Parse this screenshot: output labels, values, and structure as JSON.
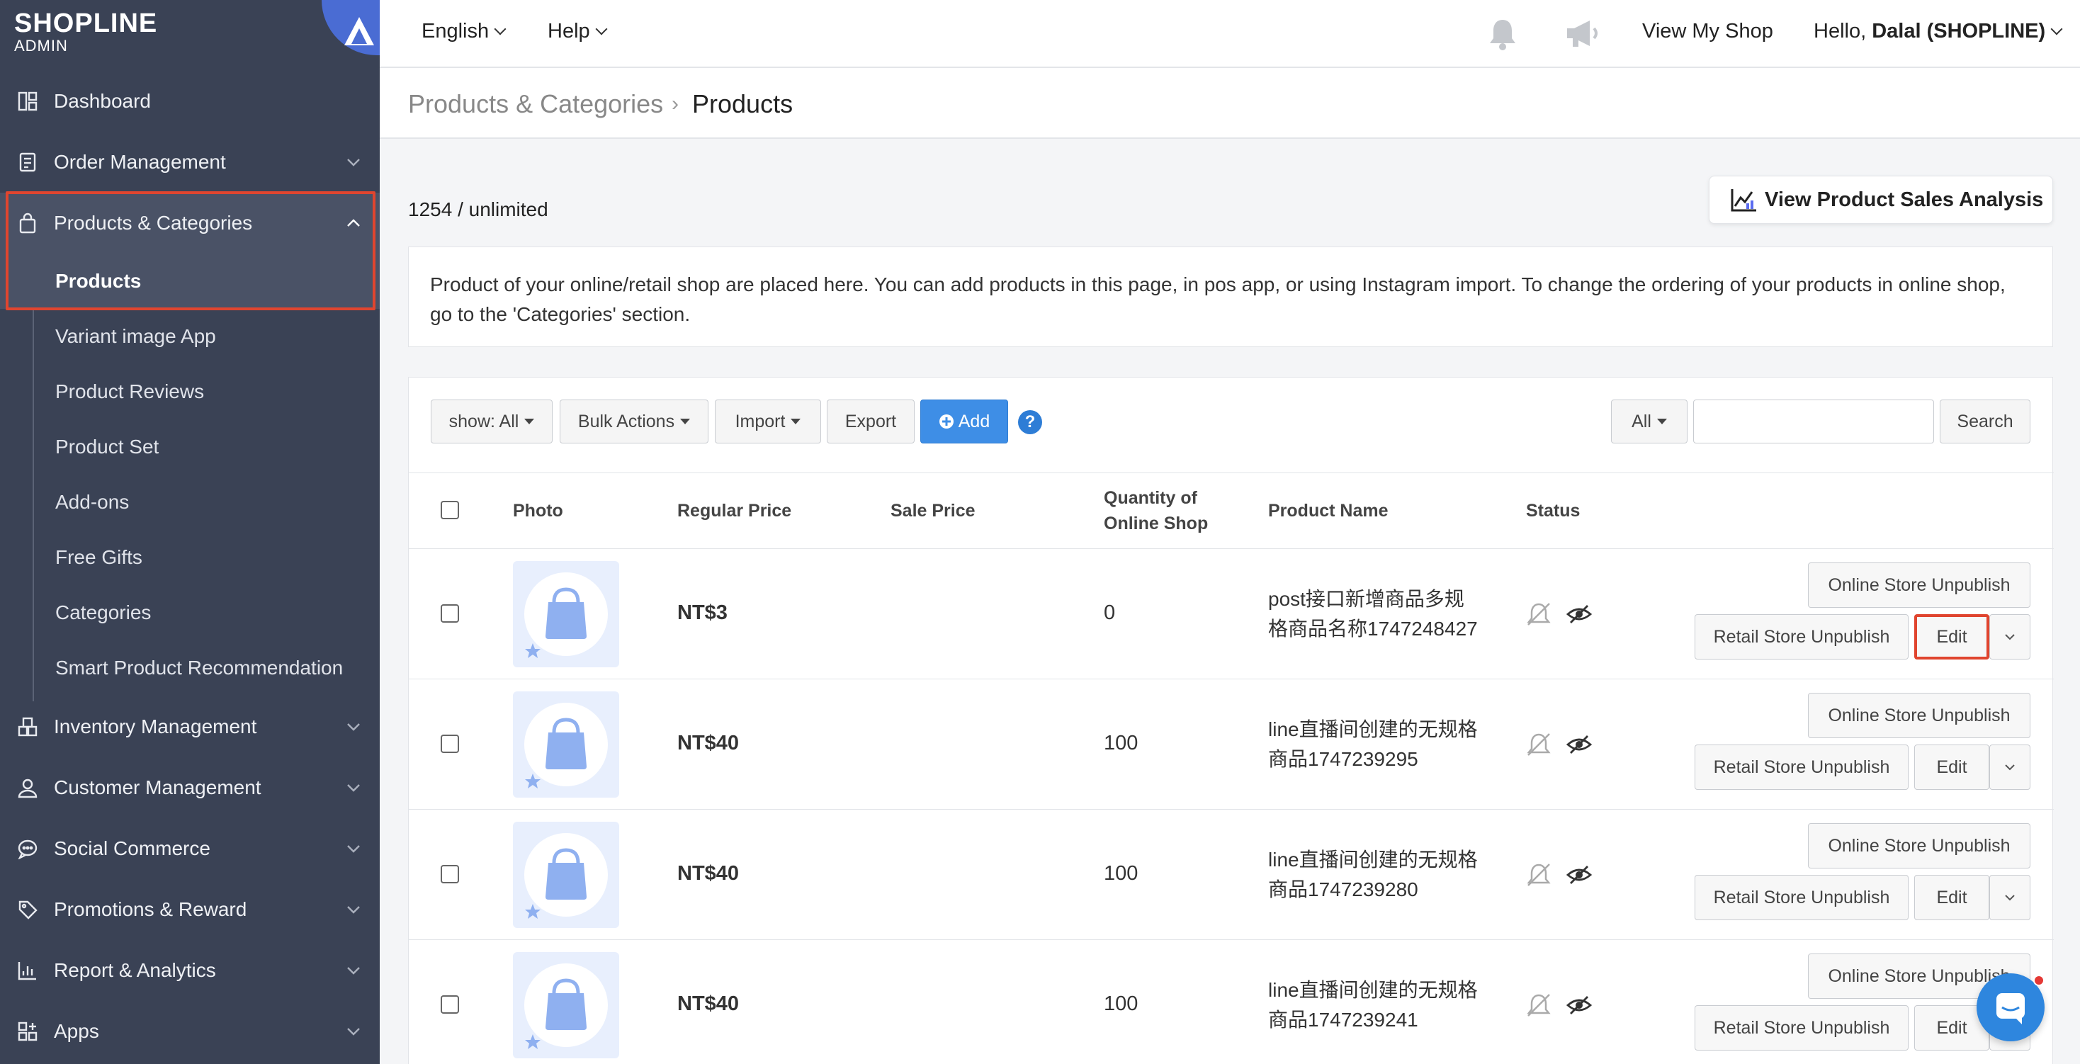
{
  "brand": {
    "logo": "SHOPLINE",
    "sub": "ADMIN"
  },
  "sidebar": {
    "items": [
      {
        "label": "Dashboard",
        "icon": "dashboard-icon"
      },
      {
        "label": "Order Management",
        "icon": "order-icon"
      },
      {
        "label": "Products & Categories",
        "icon": "bag-icon"
      },
      {
        "label": "Inventory Management",
        "icon": "inventory-icon"
      },
      {
        "label": "Customer Management",
        "icon": "user-icon"
      },
      {
        "label": "Social Commerce",
        "icon": "chat-icon"
      },
      {
        "label": "Promotions & Reward",
        "icon": "tag-icon"
      },
      {
        "label": "Report & Analytics",
        "icon": "chart-icon"
      },
      {
        "label": "Apps",
        "icon": "apps-icon"
      }
    ],
    "subitems": [
      "Products",
      "Variant image App",
      "Product Reviews",
      "Product Set",
      "Add-ons",
      "Free Gifts",
      "Categories",
      "Smart Product Recommendation"
    ]
  },
  "topbar": {
    "language": "English",
    "help": "Help",
    "view_shop": "View My Shop",
    "greeting": "Hello, ",
    "user": "Dalal (SHOPLINE)"
  },
  "breadcrumb": {
    "parent": "Products & Categories",
    "current": "Products"
  },
  "page": {
    "count": "1254 / unlimited",
    "sales_button": "View Product Sales Analysis",
    "info": "Product of your online/retail shop are placed here. You can add products in this page, in pos app, or using Instagram import. To change the ordering of your products in online shop, go to the 'Categories' section."
  },
  "toolbar": {
    "show": "show: All",
    "bulk": "Bulk Actions",
    "import": "Import",
    "export": "Export",
    "add": "Add",
    "help": "?",
    "filter": "All",
    "search_placeholder": "",
    "search": "Search"
  },
  "table": {
    "headers": {
      "photo": "Photo",
      "regular_price": "Regular Price",
      "sale_price": "Sale Price",
      "qty_line1": "Quantity of",
      "qty_line2": "Online Shop",
      "name": "Product Name",
      "status": "Status"
    },
    "rows": [
      {
        "price": "NT$3",
        "qty": "0",
        "name_l1": "post接口新增商品多规",
        "name_l2": "格商品名称1747248427"
      },
      {
        "price": "NT$40",
        "qty": "100",
        "name_l1": "line直播间创建的无规格",
        "name_l2": "商品1747239295"
      },
      {
        "price": "NT$40",
        "qty": "100",
        "name_l1": "line直播间创建的无规格",
        "name_l2": "商品1747239280"
      },
      {
        "price": "NT$40",
        "qty": "100",
        "name_l1": "line直播间创建的无规格",
        "name_l2": "商品1747239241"
      }
    ],
    "actions": {
      "online_unpublish": "Online Store Unpublish",
      "retail_unpublish": "Retail Store Unpublish",
      "edit": "Edit"
    }
  },
  "colors": {
    "sidebar": "#3a4255",
    "accent": "#3e8ee6",
    "highlight": "#e0452f"
  }
}
